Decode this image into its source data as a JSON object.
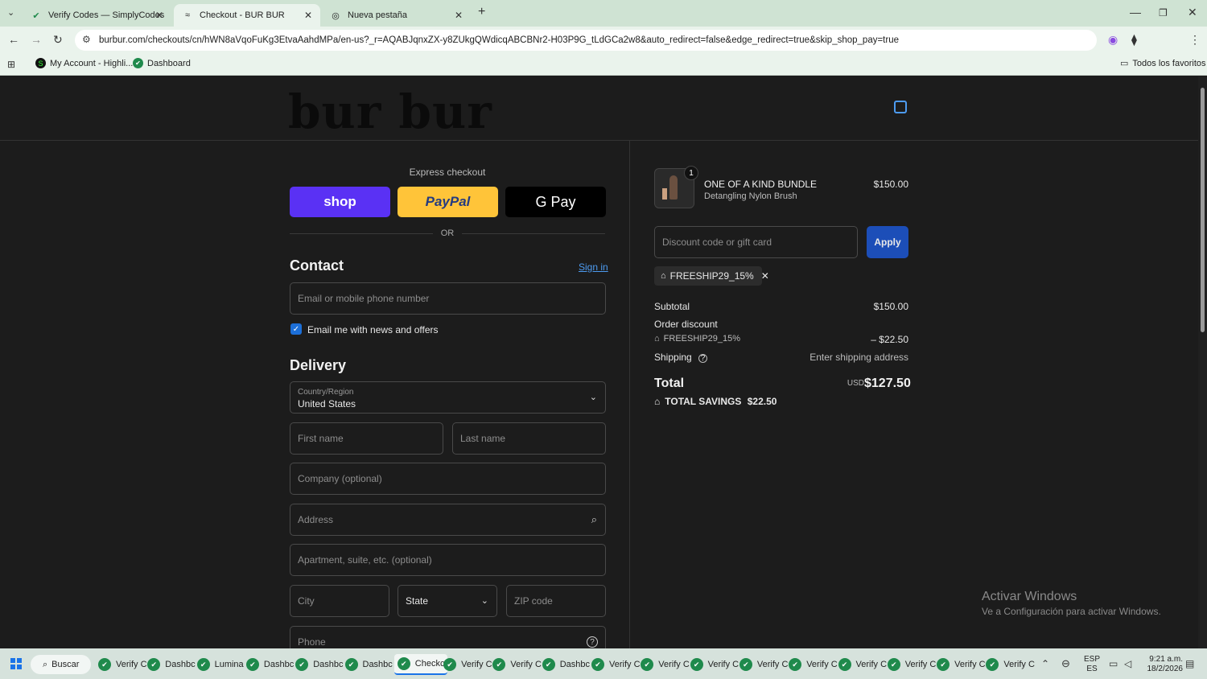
{
  "browser": {
    "tabs": [
      {
        "title": "Verify Codes — SimplyCodes"
      },
      {
        "title": "Checkout - BUR BUR"
      },
      {
        "title": "Nueva pestaña"
      }
    ],
    "url": "burbur.com/checkouts/cn/hWN8aVqoFuKg3EtvaAahdMPa/en-us?_r=AQABJqnxZX-y8ZUkgQWdicqABCBNr2-H03P9G_tLdGCa2w8&auto_redirect=false&edge_redirect=true&skip_shop_pay=true",
    "bookmarks": [
      {
        "label": "My Account - Highli..."
      },
      {
        "label": "Dashboard"
      }
    ],
    "all_bookmarks": "Todos los favoritos",
    "profile_initial": "D"
  },
  "store": {
    "logo_text": "bur bur"
  },
  "checkout": {
    "express_title": "Express checkout",
    "shop_label": "shop",
    "paypal_label": "PayPal",
    "gpay_label": "G Pay",
    "or_label": "OR",
    "contact_title": "Contact",
    "sign_in": "Sign in",
    "email_placeholder": "Email or mobile phone number",
    "newsletter_label": "Email me with news and offers",
    "delivery_title": "Delivery",
    "country_label": "Country/Region",
    "country_value": "United States",
    "first_name": "First name",
    "last_name": "Last name",
    "company": "Company (optional)",
    "address": "Address",
    "apartment": "Apartment, suite, etc. (optional)",
    "city": "City",
    "state": "State",
    "zip": "ZIP code",
    "phone": "Phone"
  },
  "summary": {
    "item_qty": "1",
    "item_name": "ONE OF A KIND BUNDLE",
    "item_variant": "Detangling Nylon Brush",
    "item_price": "$150.00",
    "discount_placeholder": "Discount code or gift card",
    "apply_label": "Apply",
    "applied_code": "FREESHIP29_15%",
    "subtotal_label": "Subtotal",
    "subtotal_value": "$150.00",
    "order_discount_label": "Order discount",
    "discount_code": "FREESHIP29_15%",
    "discount_value": "– $22.50",
    "shipping_label": "Shipping",
    "shipping_value": "Enter shipping address",
    "total_label": "Total",
    "currency": "USD",
    "total_value": "$127.50",
    "savings_label": "TOTAL SAVINGS",
    "savings_value": "$22.50"
  },
  "watermark": {
    "line1": "Activar Windows",
    "line2": "Ve a Configuración para activar Windows."
  },
  "taskbar": {
    "search_label": "Buscar",
    "apps": [
      "Verify C",
      "Dashbc",
      "Lumina",
      "Dashbc",
      "Dashbc",
      "Dashbc",
      "Checkc",
      "Verify C",
      "Verify C",
      "Dashbc",
      "Verify C",
      "Verify C",
      "Verify C",
      "Verify C",
      "Verify C",
      "Verify C",
      "Verify C",
      "Verify C",
      "Verify C"
    ],
    "lang1": "ESP",
    "lang2": "ES",
    "time": "9:21 a.m.",
    "date": "18/2/2026"
  },
  "colors": {
    "shop": "#5a31f4",
    "paypal": "#ffc439",
    "apply": "#1c4eb8",
    "checkbox": "#1c6fd8",
    "link": "#4d9bf0"
  }
}
